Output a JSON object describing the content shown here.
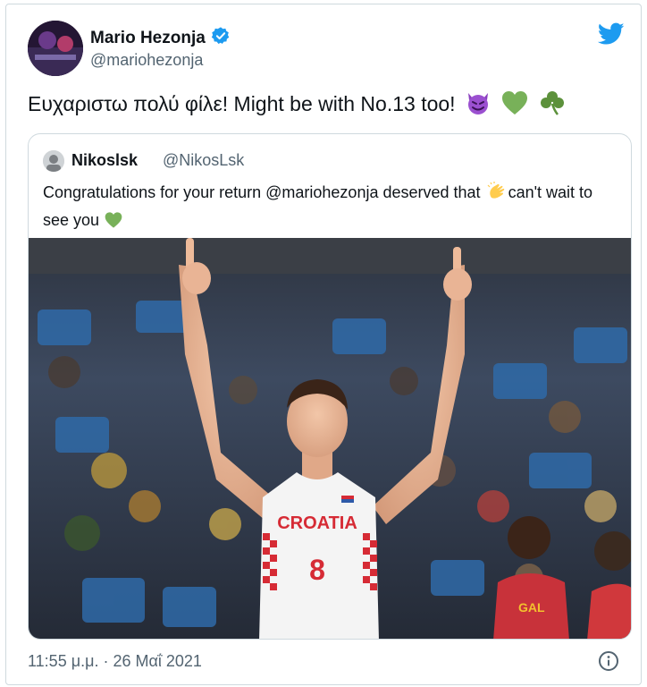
{
  "author": {
    "name": "Mario Hezonja",
    "handle": "@mariohezonja",
    "verified": true
  },
  "tweet": {
    "text": "Ευχαριστω πολύ φίλε! Might be with No.13 too!",
    "emojis": [
      "smiling-devil",
      "green-heart",
      "shamrock"
    ]
  },
  "quoted": {
    "name": "Nikoslsk",
    "handle": "@NikosLsk",
    "text_before_emoji": "Congratulations for your return @mariohezonja deserved that",
    "text_after_emoji": "can't wait to see you",
    "jersey": {
      "team": "CROATIA",
      "number": "8"
    },
    "bg_jersey": {
      "text": "GAL"
    }
  },
  "footer": {
    "timestamp": "11:55 μ.μ. · 26 Μαΐ 2021"
  },
  "colors": {
    "twitter_blue": "#1d9bf0",
    "text_primary": "#0f1419",
    "text_secondary": "#536471",
    "border": "#cfd9de",
    "jersey_red": "#d62b35"
  }
}
